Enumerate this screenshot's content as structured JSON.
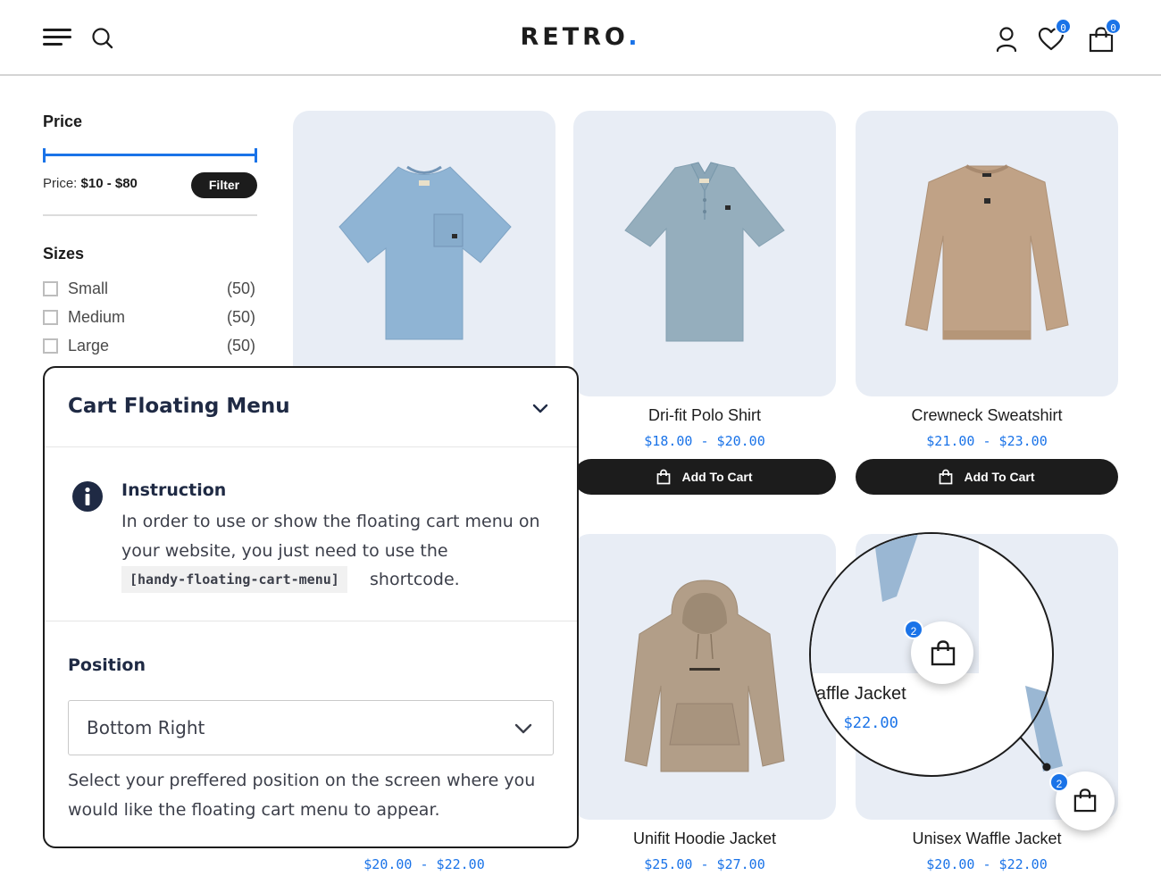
{
  "header": {
    "logo_text": "RETRO",
    "logo_dot": ".",
    "wishlist_count": "0",
    "cart_count": "0"
  },
  "filters": {
    "price_title": "Price",
    "price_range_prefix": "Price:",
    "price_range_value": "$10 - $80",
    "filter_button": "Filter",
    "sizes_title": "Sizes",
    "sizes": [
      {
        "label": "Small",
        "count": "(50)"
      },
      {
        "label": "Medium",
        "count": "(50)"
      },
      {
        "label": "Large",
        "count": "(50)"
      }
    ]
  },
  "products": [
    {
      "name": "Dri-fit Polo Shirt",
      "price": "$18.00 - $20.00",
      "button": "Add To Cart"
    },
    {
      "name": "Crewneck Sweatshirt",
      "price": "$21.00 - $23.00",
      "button": "Add To Cart"
    },
    {
      "name": "Unifit Hoodie Jacket",
      "price": "$25.00 - $27.00"
    },
    {
      "name": "Unisex Waffle Jacket",
      "price": "$20.00 - $22.00"
    },
    {
      "price": "$20.00 - $22.00"
    }
  ],
  "magnifier": {
    "name": "'affle Jacket",
    "price": "- $22.00",
    "badge": "2"
  },
  "floating_cart": {
    "badge": "2"
  },
  "panel": {
    "title": "Cart Floating Menu",
    "instruction_title": "Instruction",
    "instruction_text": "In order to use or show the floating cart menu on your website, you just need to use the",
    "shortcode": "[handy-floating-cart-menu]",
    "instruction_tail": "shortcode.",
    "position_label": "Position",
    "position_value": "Bottom Right",
    "position_help": "Select your preffered position on the screen where you would like the floating cart menu to appear."
  },
  "colors": {
    "accent": "#1a73e8",
    "dark": "#1c1c1c",
    "card_bg": "#e8edf5"
  }
}
